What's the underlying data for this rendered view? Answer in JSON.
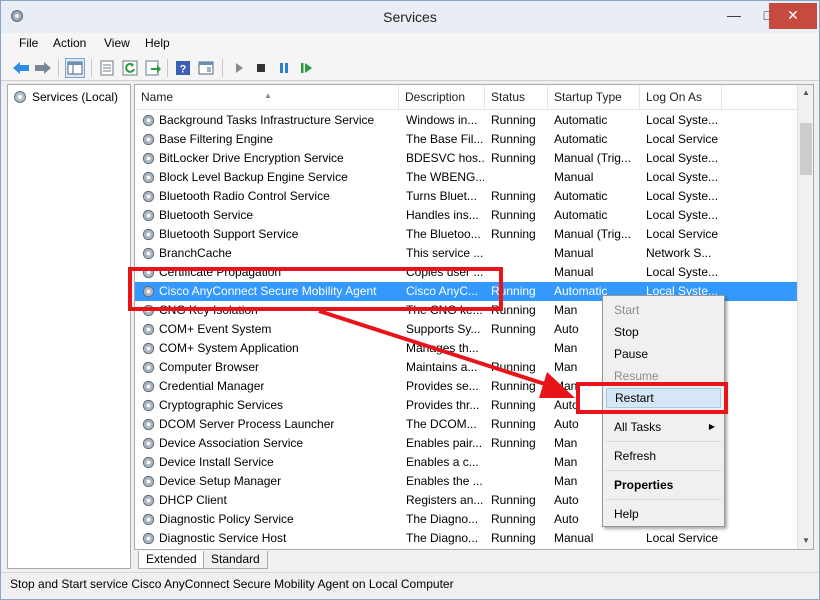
{
  "window": {
    "title": "Services"
  },
  "menu": [
    "File",
    "Action",
    "View",
    "Help"
  ],
  "tree": {
    "item": "Services (Local)"
  },
  "columns": {
    "name": "Name",
    "description": "Description",
    "status": "Status",
    "startup": "Startup Type",
    "logon": "Log On As"
  },
  "rows": [
    {
      "name": "Background Tasks Infrastructure Service",
      "desc": "Windows in...",
      "status": "Running",
      "startup": "Automatic",
      "logon": "Local Syste..."
    },
    {
      "name": "Base Filtering Engine",
      "desc": "The Base Fil...",
      "status": "Running",
      "startup": "Automatic",
      "logon": "Local Service"
    },
    {
      "name": "BitLocker Drive Encryption Service",
      "desc": "BDESVC hos...",
      "status": "Running",
      "startup": "Manual (Trig...",
      "logon": "Local Syste..."
    },
    {
      "name": "Block Level Backup Engine Service",
      "desc": "The WBENG...",
      "status": "",
      "startup": "Manual",
      "logon": "Local Syste..."
    },
    {
      "name": "Bluetooth Radio Control Service",
      "desc": "Turns Bluet...",
      "status": "Running",
      "startup": "Automatic",
      "logon": "Local Syste..."
    },
    {
      "name": "Bluetooth Service",
      "desc": "Handles ins...",
      "status": "Running",
      "startup": "Automatic",
      "logon": "Local Syste..."
    },
    {
      "name": "Bluetooth Support Service",
      "desc": "The Bluetoo...",
      "status": "Running",
      "startup": "Manual (Trig...",
      "logon": "Local Service"
    },
    {
      "name": "BranchCache",
      "desc": "This service ...",
      "status": "",
      "startup": "Manual",
      "logon": "Network S..."
    },
    {
      "name": "Certificate Propagation",
      "desc": "Copies user ...",
      "status": "",
      "startup": "Manual",
      "logon": "Local Syste..."
    },
    {
      "name": "Cisco AnyConnect Secure Mobility Agent",
      "desc": "Cisco AnyC...",
      "status": "Running",
      "startup": "Automatic",
      "logon": "Local Syste..."
    },
    {
      "name": "CNG Key Isolation",
      "desc": "The CNG ke...",
      "status": "Running",
      "startup": "Man",
      "logon": ""
    },
    {
      "name": "COM+ Event System",
      "desc": "Supports Sy...",
      "status": "Running",
      "startup": "Auto",
      "logon": ""
    },
    {
      "name": "COM+ System Application",
      "desc": "Manages th...",
      "status": "",
      "startup": "Man",
      "logon": ""
    },
    {
      "name": "Computer Browser",
      "desc": "Maintains a...",
      "status": "Running",
      "startup": "Man",
      "logon": ""
    },
    {
      "name": "Credential Manager",
      "desc": "Provides se...",
      "status": "Running",
      "startup": "Man",
      "logon": ""
    },
    {
      "name": "Cryptographic Services",
      "desc": "Provides thr...",
      "status": "Running",
      "startup": "Auto",
      "logon": ""
    },
    {
      "name": "DCOM Server Process Launcher",
      "desc": "The DCOM...",
      "status": "Running",
      "startup": "Auto",
      "logon": ""
    },
    {
      "name": "Device Association Service",
      "desc": "Enables pair...",
      "status": "Running",
      "startup": "Man",
      "logon": ""
    },
    {
      "name": "Device Install Service",
      "desc": "Enables a c...",
      "status": "",
      "startup": "Man",
      "logon": ""
    },
    {
      "name": "Device Setup Manager",
      "desc": "Enables the ...",
      "status": "",
      "startup": "Man",
      "logon": ""
    },
    {
      "name": "DHCP Client",
      "desc": "Registers an...",
      "status": "Running",
      "startup": "Auto",
      "logon": ""
    },
    {
      "name": "Diagnostic Policy Service",
      "desc": "The Diagno...",
      "status": "Running",
      "startup": "Auto",
      "logon": ""
    },
    {
      "name": "Diagnostic Service Host",
      "desc": "The Diagno...",
      "status": "Running",
      "startup": "Manual",
      "logon": "Local Service"
    }
  ],
  "selected_row": "Cisco AnyConnect Secure Mobility Agent",
  "context_menu": {
    "start": "Start",
    "stop": "Stop",
    "pause": "Pause",
    "resume": "Resume",
    "restart": "Restart",
    "all_tasks": "All Tasks",
    "refresh": "Refresh",
    "properties": "Properties",
    "help": "Help"
  },
  "tabs": {
    "extended": "Extended",
    "standard": "Standard"
  },
  "status_bar": "Stop and Start service Cisco AnyConnect Secure Mobility Agent on Local Computer",
  "colors": {
    "selection": "#3399ff",
    "annotation": "#e8141a",
    "menu_highlight": "#d5e6f7"
  },
  "icons": [
    "gear-icon",
    "back-arrow-icon",
    "forward-arrow-icon",
    "play-icon",
    "stop-icon",
    "pause-icon",
    "resume-icon"
  ]
}
